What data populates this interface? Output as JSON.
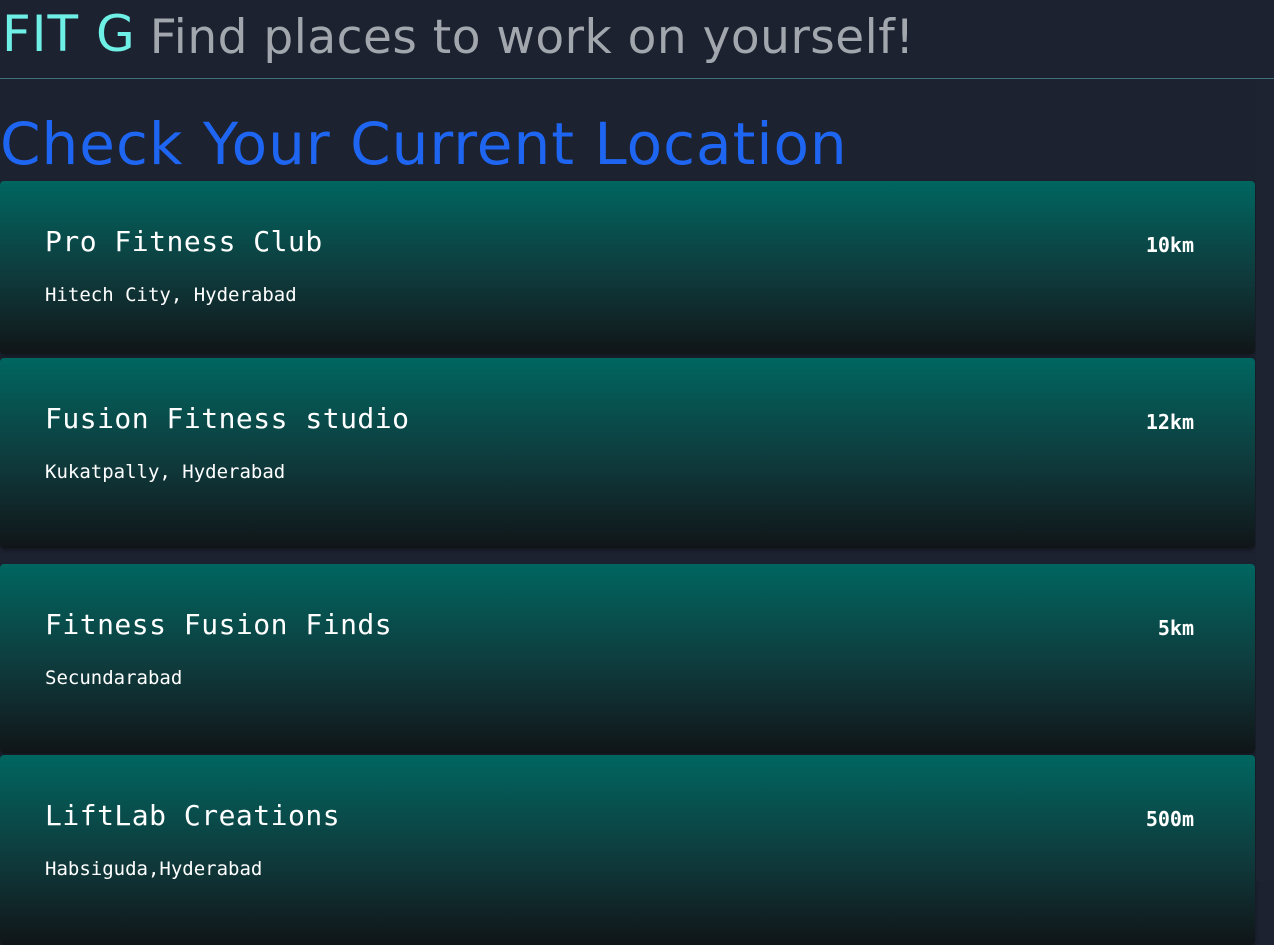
{
  "header": {
    "brand": "FIT G",
    "tagline": "Find places to work on yourself!"
  },
  "main": {
    "title": "Check Your Current Location",
    "places": [
      {
        "name": "Pro Fitness Club",
        "location": "Hitech City, Hyderabad",
        "distance": "10km"
      },
      {
        "name": "Fusion Fitness studio",
        "location": "Kukatpally, Hyderabad",
        "distance": "12km"
      },
      {
        "name": "Fitness Fusion Finds",
        "location": "Secundarabad",
        "distance": "5km"
      },
      {
        "name": "LiftLab Creations",
        "location": "Habsiguda,Hyderabad",
        "distance": "500m"
      }
    ]
  },
  "colors": {
    "background": "#1c2230",
    "brand": "#6ff0e6",
    "title": "#1e66f2",
    "card_top": "#006660"
  }
}
